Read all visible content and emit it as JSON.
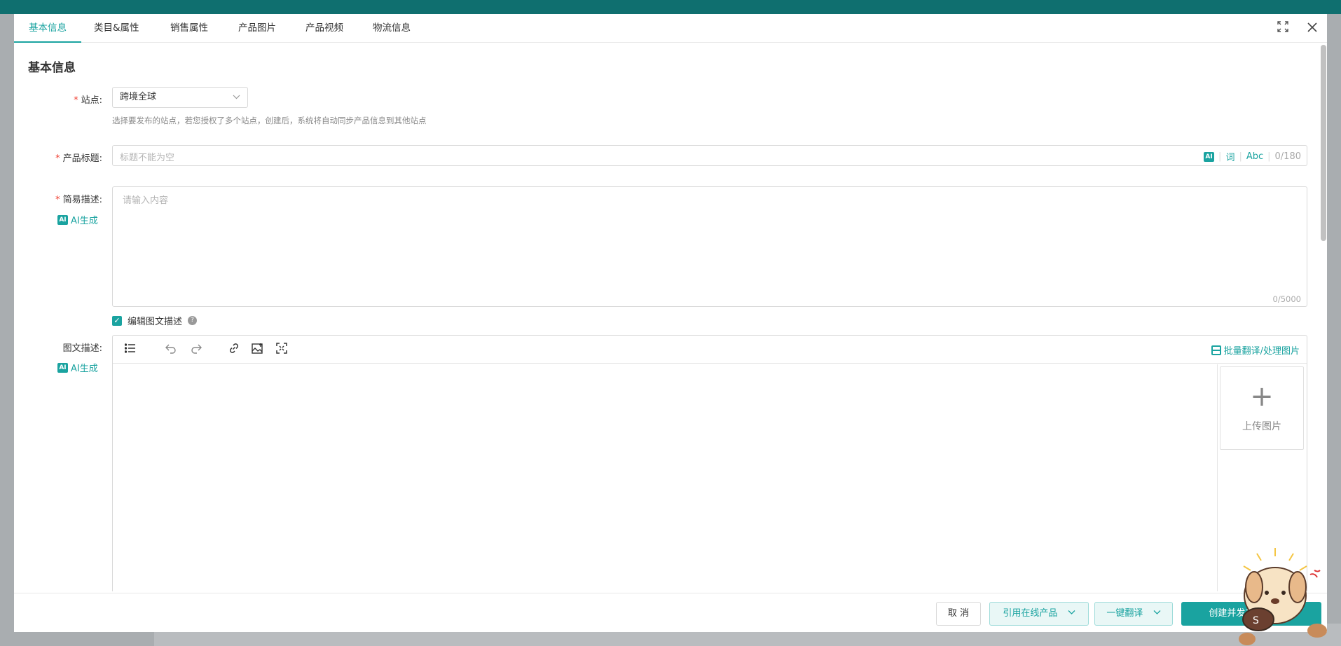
{
  "tabs": [
    {
      "label": "基本信息"
    },
    {
      "label": "类目&属性"
    },
    {
      "label": "销售属性"
    },
    {
      "label": "产品图片"
    },
    {
      "label": "产品视频"
    },
    {
      "label": "物流信息"
    }
  ],
  "section_title": "基本信息",
  "site": {
    "label": "站点:",
    "value": "跨境全球",
    "hint": "选择要发布的站点，若您授权了多个站点，创建后，系统将自动同步产品信息到其他站点"
  },
  "product_title": {
    "label": "产品标题:",
    "placeholder": "标题不能为空",
    "ai": "AI",
    "word": "词",
    "abc": "Abc",
    "count": "0/180"
  },
  "short_desc": {
    "label": "简易描述:",
    "placeholder": "请输入内容",
    "count": "0/5000",
    "ai_gen": "AI生成"
  },
  "rich_toggle": {
    "label": "编辑图文描述",
    "checked": true,
    "help": "?"
  },
  "rich_desc": {
    "label": "图文描述:",
    "ai_gen": "AI生成",
    "batch_label": "批量翻译/处理图片",
    "upload_label": "上传图片",
    "upload_plus": "+"
  },
  "toolbar_icons": [
    "list-icon",
    "undo-icon",
    "redo-icon",
    "link-icon",
    "image-icon",
    "fullscreen-icon"
  ],
  "footer": {
    "cancel": "取 消",
    "reference": "引用在线产品",
    "translate": "一键翻译",
    "create": "创建并发布 完成创建"
  },
  "colors": {
    "accent": "#1aa3a0",
    "required": "#f04134"
  }
}
